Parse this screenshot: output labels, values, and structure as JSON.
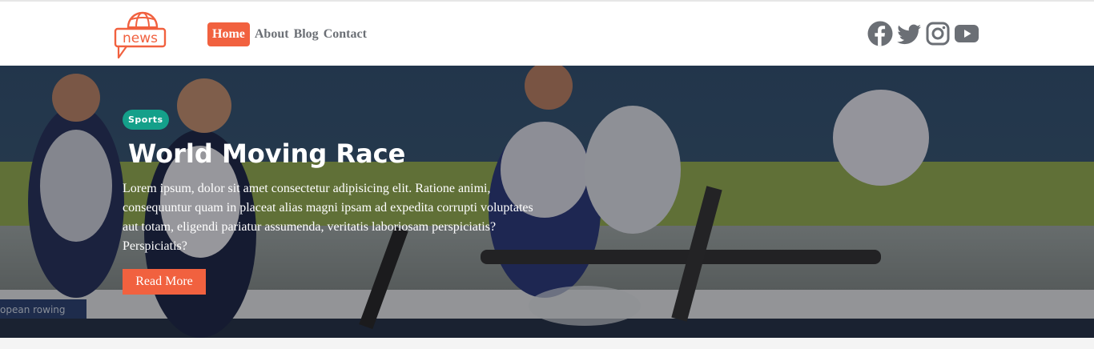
{
  "logo": {
    "text": "news",
    "icon": "globe-speech-bubble-logo",
    "color": "#f1613f"
  },
  "nav": {
    "items": [
      {
        "label": "Home",
        "active": true
      },
      {
        "label": "About",
        "active": false
      },
      {
        "label": "Blog",
        "active": false
      },
      {
        "label": "Contact",
        "active": false
      }
    ],
    "active_color": "#f1613f"
  },
  "socials": [
    {
      "icon": "facebook-icon"
    },
    {
      "icon": "twitter-icon"
    },
    {
      "icon": "instagram-icon"
    },
    {
      "icon": "youtube-icon"
    }
  ],
  "hero": {
    "category": "Sports",
    "category_color": "#14a08a",
    "title": "World Moving Race",
    "text": "Lorem ipsum, dolor sit amet consectetur adipisicing elit. Ratione animi, consequuntur quam in placeat alias magni ipsam ad expedita corrupti voluptates aut totam, eligendi pariatur assumenda, veritatis laboriosam perspiciatis? Perspiciatis?",
    "button_label": "Read More",
    "button_color": "#f1613f",
    "background_subject": "women's rowing crew photo",
    "banner_text": "opean rowing"
  }
}
